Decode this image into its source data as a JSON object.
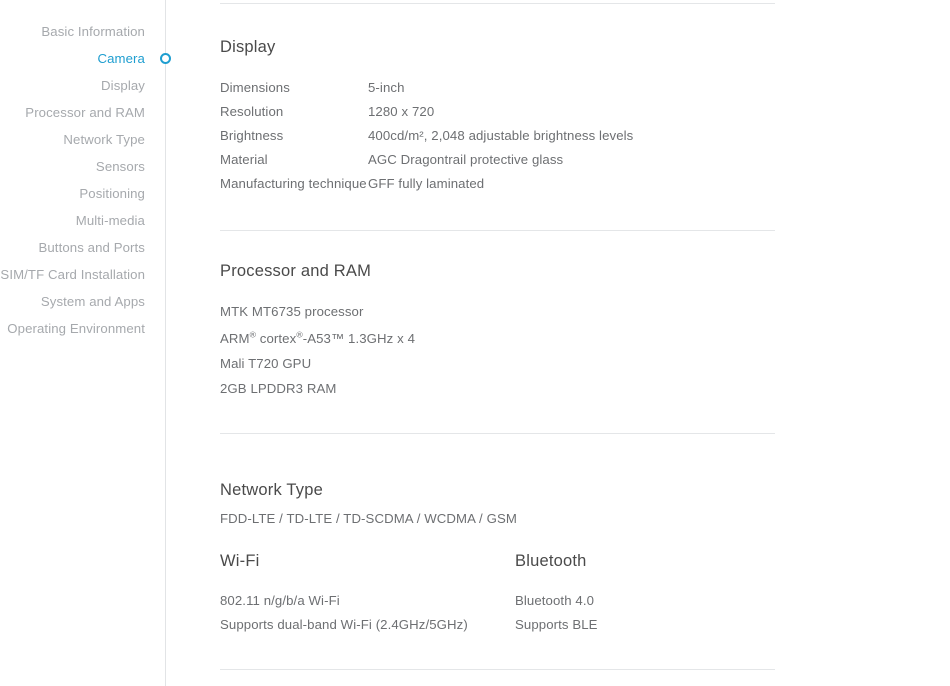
{
  "nav": {
    "active_label": "Camera",
    "items": [
      {
        "label": "Basic Information",
        "active": false
      },
      {
        "label": "Camera",
        "active": true
      },
      {
        "label": "Display",
        "active": false
      },
      {
        "label": "Processor and RAM",
        "active": false
      },
      {
        "label": "Network Type",
        "active": false
      },
      {
        "label": "Sensors",
        "active": false
      },
      {
        "label": "Positioning",
        "active": false
      },
      {
        "label": "Multi-media",
        "active": false
      },
      {
        "label": "Buttons and Ports",
        "active": false
      },
      {
        "label": "SIM/TF Card Installation",
        "active": false
      },
      {
        "label": "System and Apps",
        "active": false
      },
      {
        "label": "Operating Environment",
        "active": false
      }
    ]
  },
  "colors": {
    "accent": "#1f9ed0",
    "nav_text": "#a6a9ad",
    "heading": "#4a4a4a",
    "body_text": "#6d6f72",
    "rule": "#e4e6e8"
  },
  "sections": {
    "display": {
      "title": "Display",
      "rows": [
        {
          "label": "Dimensions",
          "value": "5-inch"
        },
        {
          "label": "Resolution",
          "value": "1280 x 720"
        },
        {
          "label": "Brightness",
          "value": "400cd/m², 2,048 adjustable brightness levels"
        },
        {
          "label": "Material",
          "value": "AGC Dragontrail protective glass"
        },
        {
          "label": "Manufacturing technique",
          "value": "GFF fully laminated"
        }
      ]
    },
    "processor": {
      "title": "Processor and RAM",
      "lines": [
        "MTK MT6735 processor",
        "Mali T720 GPU",
        "2GB LPDDR3 RAM"
      ],
      "arm": {
        "prefix": "ARM",
        "reg1": "®",
        "mid": " cortex",
        "reg2": "®",
        "suffix": "-A53™ 1.3GHz x 4"
      }
    },
    "network": {
      "title": "Network Type",
      "value": "FDD-LTE / TD-LTE / TD-SCDMA / WCDMA / GSM"
    },
    "wifi": {
      "title": "Wi-Fi",
      "lines": [
        "802.11 n/g/b/a Wi-Fi",
        "Supports dual-band Wi-Fi (2.4GHz/5GHz)"
      ]
    },
    "bluetooth": {
      "title": "Bluetooth",
      "lines": [
        "Bluetooth 4.0",
        "Supports BLE"
      ]
    }
  }
}
